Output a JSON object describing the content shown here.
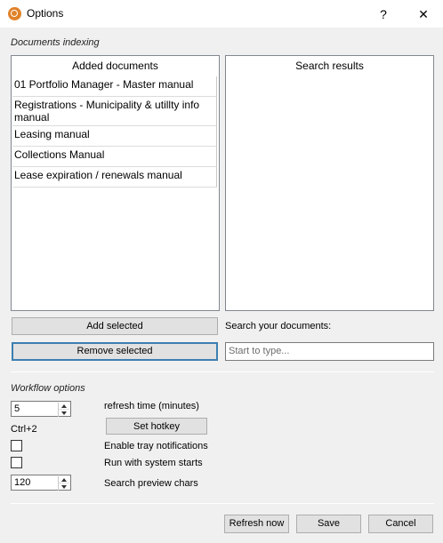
{
  "window": {
    "title": "Options",
    "help_glyph": "?",
    "close_glyph": "✕"
  },
  "documents_indexing": {
    "section_label": "Documents indexing",
    "added_documents": {
      "header": "Added documents",
      "items": [
        "01 Portfolio Manager - Master manual",
        "Registrations - Municipality & utillty info manual",
        "Leasing manual",
        "Collections Manual",
        "Lease expiration / renewals manual"
      ]
    },
    "search_results": {
      "header": "Search results"
    },
    "add_selected_label": "Add selected",
    "remove_selected_label": "Remove selected",
    "search_label": "Search your documents:",
    "search_placeholder": "Start to type..."
  },
  "workflow_options": {
    "section_label": "Workflow options",
    "refresh_time_value": "5",
    "refresh_time_label": "refresh time (minutes)",
    "hotkey_text": "Ctrl+2",
    "set_hotkey_label": "Set hotkey",
    "tray_notifications_label": "Enable tray notifications",
    "tray_notifications_checked": false,
    "run_with_system_label": "Run with system starts",
    "run_with_system_checked": false,
    "preview_chars_value": "120",
    "preview_chars_label": "Search preview chars"
  },
  "footer": {
    "refresh_now_label": "Refresh now",
    "save_label": "Save",
    "cancel_label": "Cancel"
  }
}
